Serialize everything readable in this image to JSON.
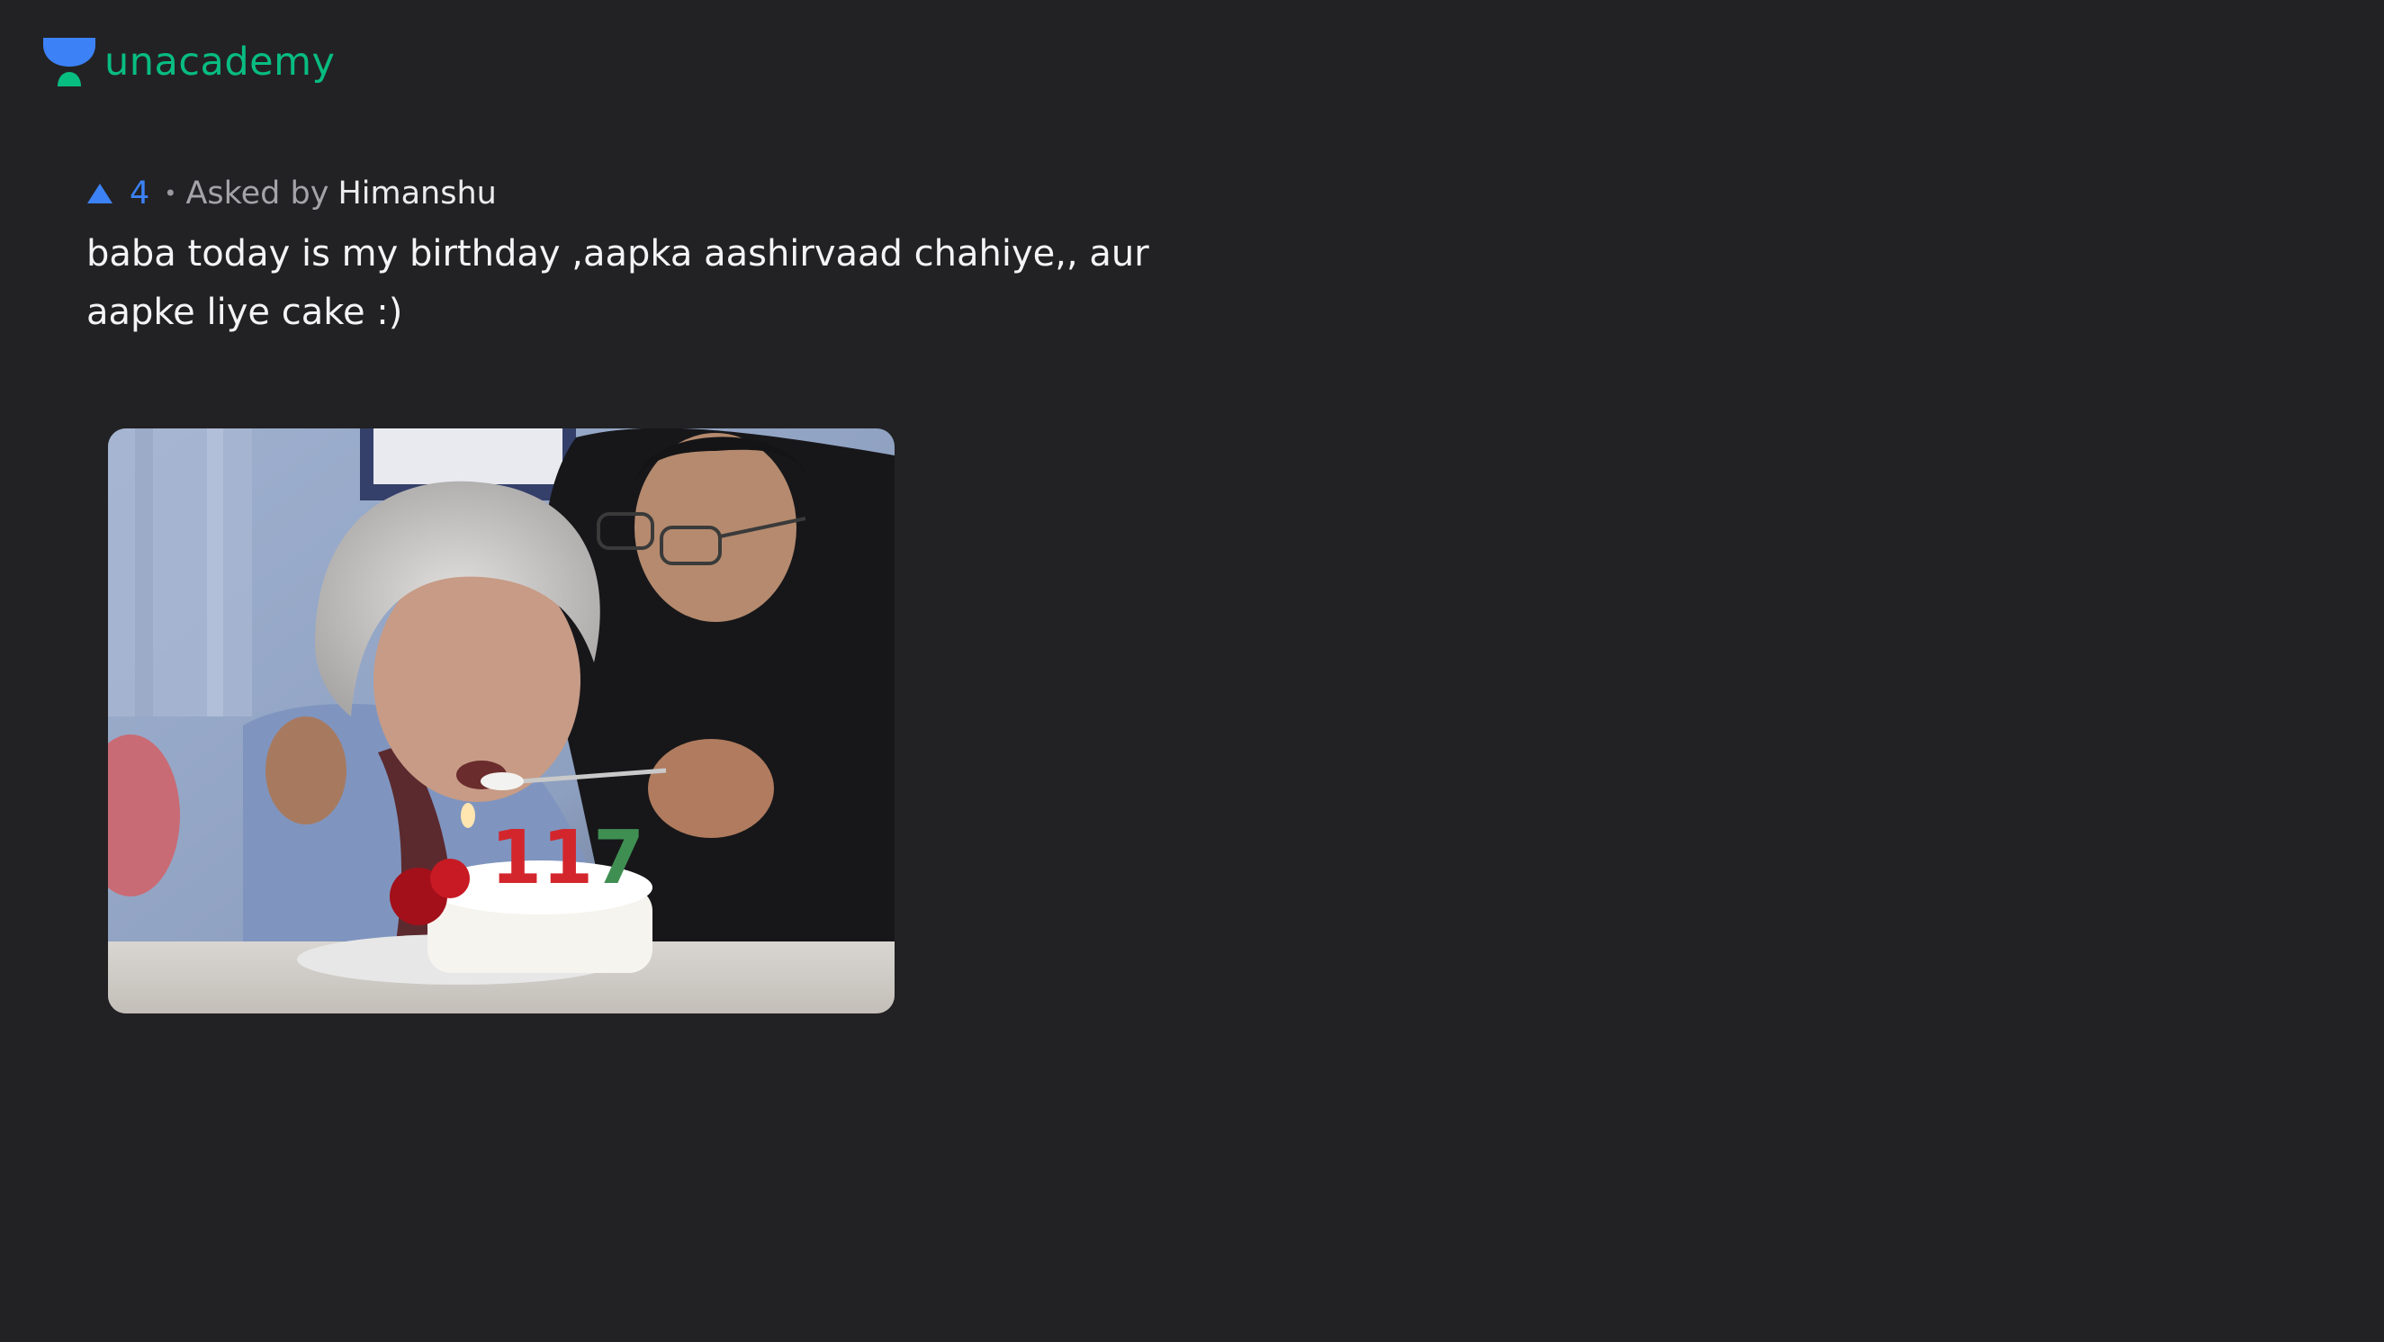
{
  "brand": {
    "name": "unacademy",
    "accent": "#08bd80",
    "icon": "unacademy-logo-icon"
  },
  "post": {
    "upvote_icon": "upvote-arrow-icon",
    "upvote_count": "4",
    "separator": "•",
    "asked_by_label": "Asked by",
    "author": "Himanshu",
    "question": "baba today is my birthday ,aapka aashirvaad chahiye,, aur aapke liye cake :)",
    "image": {
      "description_icon": "birthday-cake-photo",
      "candle_number": "117"
    }
  },
  "colors": {
    "background": "#222224",
    "upvote": "#3c82f6",
    "text": "#f4f4f6"
  }
}
